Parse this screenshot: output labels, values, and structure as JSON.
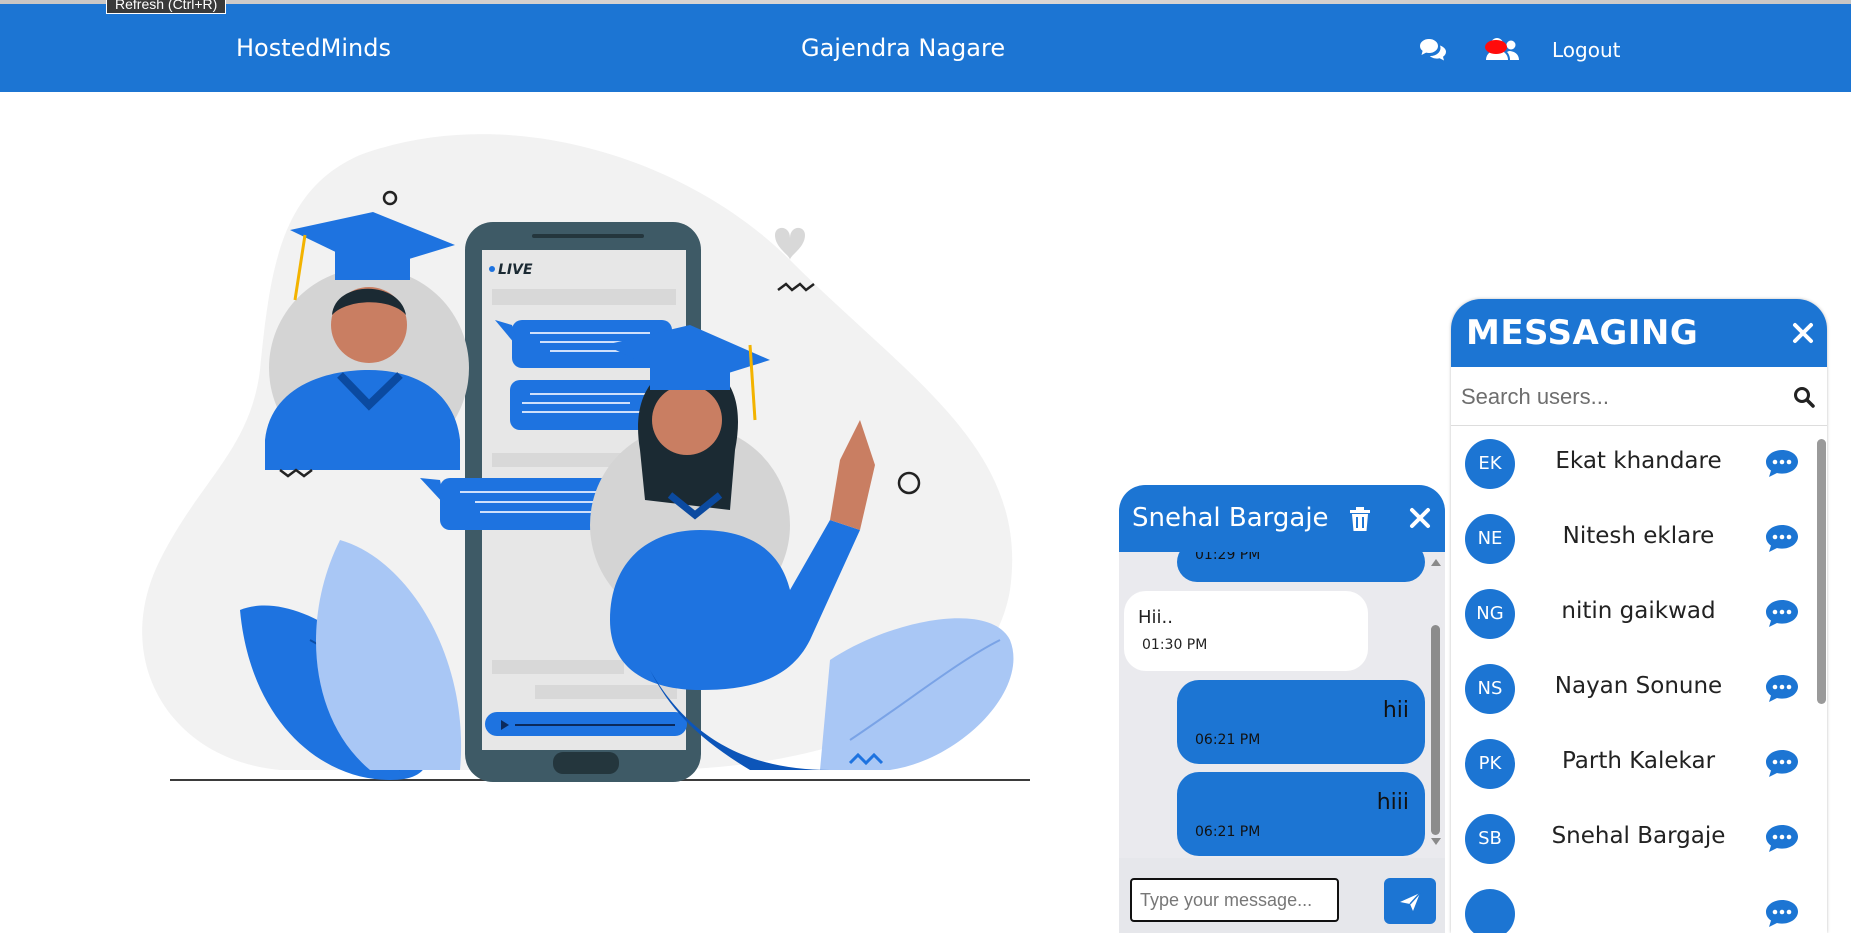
{
  "browser": {
    "tooltip": "Refresh (Ctrl+R)"
  },
  "navbar": {
    "brand": "HostedMinds",
    "username": "Gajendra Nagare",
    "logout": "Logout",
    "icons": [
      "chat-bubbles-icon",
      "friends-icon"
    ]
  },
  "hero": {
    "live_label": "LIVE"
  },
  "chat": {
    "title": "Snehal Bargaje",
    "messages": [
      {
        "dir": "out",
        "text": "",
        "time": "01:29 PM"
      },
      {
        "dir": "in",
        "text": "Hii..",
        "time": "01:30 PM"
      },
      {
        "dir": "out",
        "text": "hii",
        "time": "06:21 PM"
      },
      {
        "dir": "out",
        "text": "hiii",
        "time": "06:21 PM"
      }
    ],
    "input_placeholder": "Type your message..."
  },
  "messaging": {
    "title": "MESSAGING",
    "search_placeholder": "Search users...",
    "users": [
      {
        "initials": "EK",
        "name": "Ekat khandare"
      },
      {
        "initials": "NE",
        "name": "Nitesh eklare"
      },
      {
        "initials": "NG",
        "name": "nitin gaikwad"
      },
      {
        "initials": "NS",
        "name": "Nayan Sonune"
      },
      {
        "initials": "PK",
        "name": "Parth Kalekar"
      },
      {
        "initials": "SB",
        "name": "Snehal Bargaje"
      }
    ]
  },
  "colors": {
    "primary": "#1c75d3",
    "notification": "#ff0b0b"
  }
}
